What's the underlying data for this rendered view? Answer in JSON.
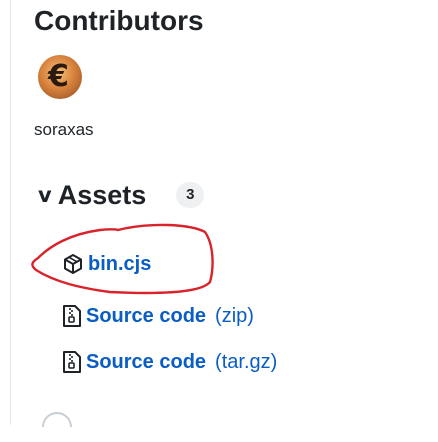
{
  "contributors": {
    "title": "Contributors",
    "users": [
      {
        "name": "soraxas",
        "avatar_glyph": "€"
      }
    ]
  },
  "assets": {
    "caret": "v",
    "title": "Assets",
    "count": "3",
    "items": [
      {
        "icon": "package-icon",
        "name": "bin.cjs",
        "suffix": ""
      },
      {
        "icon": "file-zip-icon",
        "name": "Source code",
        "suffix": "(zip)"
      },
      {
        "icon": "file-zip-icon",
        "name": "Source code",
        "suffix": "(tar.gz)"
      }
    ]
  },
  "colors": {
    "link": "#0a5dc2",
    "annotation": "#d8232a",
    "text": "#1f2328",
    "counter_bg": "#eef0f2"
  }
}
